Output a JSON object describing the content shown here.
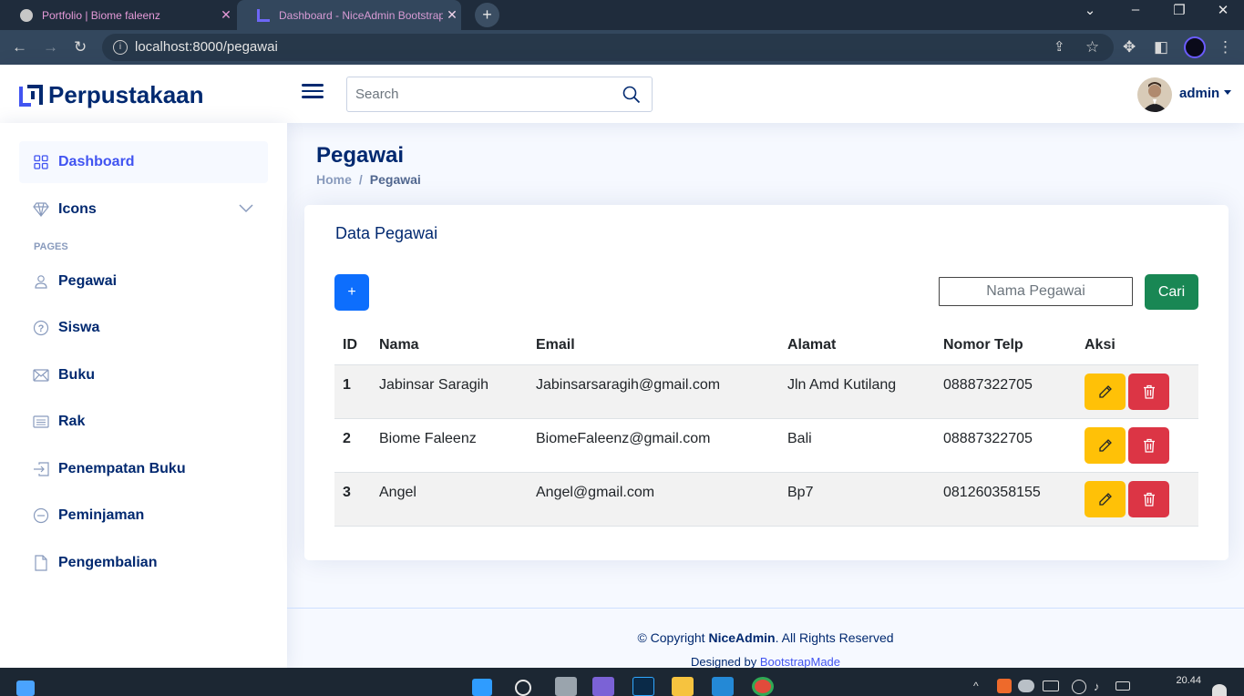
{
  "browser": {
    "tabs": [
      {
        "title": "Portfolio | Biome faleenz"
      },
      {
        "title": "Dashboard - NiceAdmin Bootstrap T"
      }
    ],
    "url": "localhost:8000/pegawai"
  },
  "header": {
    "brand": "Perpustakaan",
    "search_placeholder": "Search",
    "user": "admin"
  },
  "sidebar": {
    "items": [
      {
        "label": "Dashboard",
        "icon": "grid-icon"
      },
      {
        "label": "Icons",
        "icon": "gem-icon"
      }
    ],
    "section": "PAGES",
    "pages": [
      {
        "label": "Pegawai",
        "icon": "person-icon"
      },
      {
        "label": "Siswa",
        "icon": "question-circle-icon"
      },
      {
        "label": "Buku",
        "icon": "envelope-icon"
      },
      {
        "label": "Rak",
        "icon": "card-list-icon"
      },
      {
        "label": "Penempatan Buku",
        "icon": "box-arrow-in-right-icon"
      },
      {
        "label": "Peminjaman",
        "icon": "dash-circle-icon"
      },
      {
        "label": "Pengembalian",
        "icon": "file-icon"
      }
    ]
  },
  "main": {
    "title": "Pegawai",
    "breadcrumb": {
      "home": "Home",
      "sep": "/",
      "current": "Pegawai"
    },
    "card": {
      "title": "Data Pegawai",
      "add_label": "+",
      "search_placeholder": "Nama Pegawai",
      "search_button": "Cari",
      "columns": [
        "ID",
        "Nama",
        "Email",
        "Alamat",
        "Nomor Telp",
        "Aksi"
      ],
      "rows": [
        {
          "id": "1",
          "nama": "Jabinsar Saragih",
          "email": "Jabinsarsaragih@gmail.com",
          "alamat": "Jln Amd Kutilang",
          "telp": "08887322705"
        },
        {
          "id": "2",
          "nama": "Biome Faleenz",
          "email": "BiomeFaleenz@gmail.com",
          "alamat": "Bali",
          "telp": "08887322705"
        },
        {
          "id": "3",
          "nama": "Angel",
          "email": "Angel@gmail.com",
          "alamat": "Bp7",
          "telp": "081260358155"
        }
      ]
    }
  },
  "footer": {
    "copy_prefix": "© Copyright ",
    "brand": "NiceAdmin",
    "copy_suffix": ". All Rights Reserved",
    "designed_by": "Designed by ",
    "designer": "BootstrapMade"
  },
  "taskbar": {
    "time": "20.44"
  },
  "colors": {
    "primary": "#4154f1",
    "navy": "#012970",
    "edit": "#ffc107",
    "delete": "#dc3545",
    "search": "#198754",
    "add": "#0d6efd"
  }
}
